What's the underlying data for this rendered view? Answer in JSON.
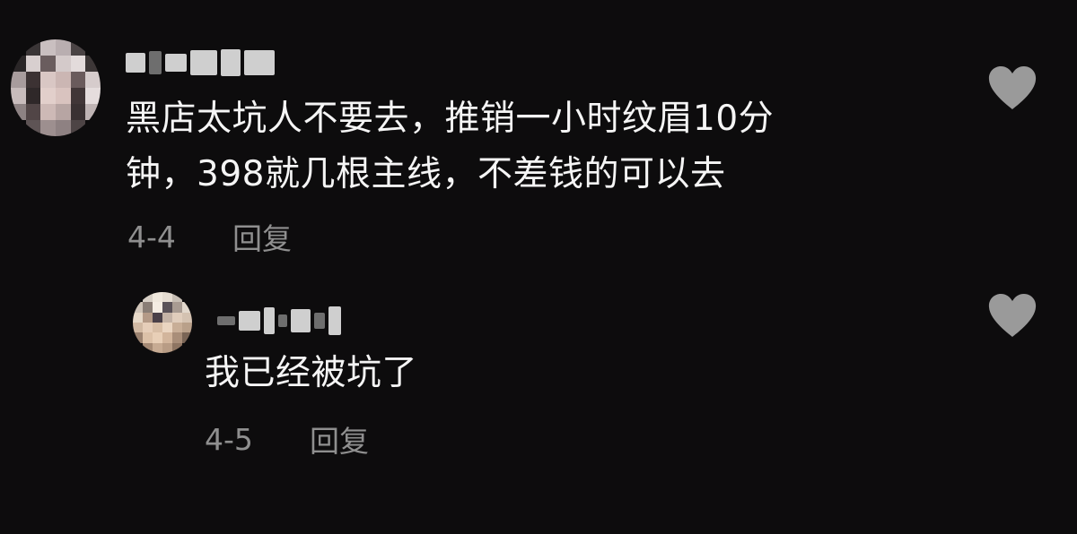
{
  "comments": [
    {
      "text_lines": [
        "黑店太坑人不要去，推销一小时纹眉10分",
        "钟，398就几根主线，不差钱的可以去"
      ],
      "date": "4-4",
      "reply_label": "回复",
      "like_icon": "heart-icon",
      "avatar_icon": "pixelated-avatar",
      "username_masked": true
    },
    {
      "text_lines": [
        "我已经被坑了"
      ],
      "date": "4-5",
      "reply_label": "回复",
      "like_icon": "heart-icon",
      "avatar_icon": "pixelated-avatar",
      "username_masked": true
    }
  ],
  "colors": {
    "background": "#0d0c0d",
    "text": "#f5f5f5",
    "meta": "#8f8f8f",
    "heart": "#9a9a9a"
  }
}
